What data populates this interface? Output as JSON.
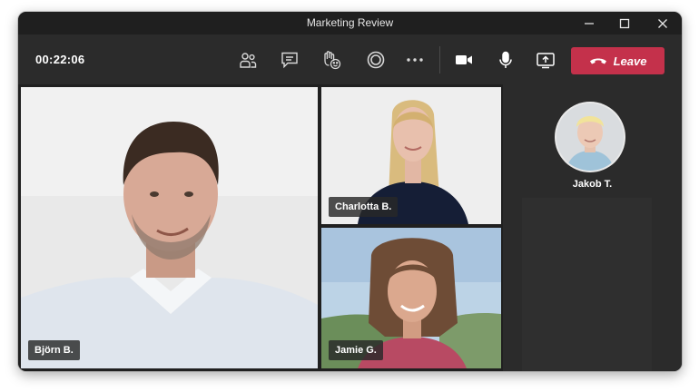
{
  "window": {
    "title": "Marketing Review",
    "controls": [
      "minimize-icon",
      "maximize-icon",
      "close-icon"
    ]
  },
  "toolbar": {
    "timer": "00:22:06",
    "buttons": [
      {
        "name": "participants",
        "icon": "people-icon"
      },
      {
        "name": "chat",
        "icon": "chat-icon"
      },
      {
        "name": "reactions",
        "icon": "raise-hand-icon"
      },
      {
        "name": "record",
        "icon": "record-icon"
      },
      {
        "name": "more",
        "icon": "more-icon"
      },
      {
        "name": "camera",
        "icon": "video-camera-icon"
      },
      {
        "name": "microphone",
        "icon": "microphone-icon"
      },
      {
        "name": "share",
        "icon": "share-screen-icon"
      }
    ],
    "leave_label": "Leave",
    "leave_color": "#c4314b"
  },
  "participants": [
    {
      "name": "Björn B."
    },
    {
      "name": "Charlotta B."
    },
    {
      "name": "Jamie G."
    },
    {
      "name": "Jakob T."
    }
  ],
  "colors": {
    "window_bg": "#292929",
    "titlebar_bg": "#1f1f1f",
    "text": "#ffffff"
  }
}
